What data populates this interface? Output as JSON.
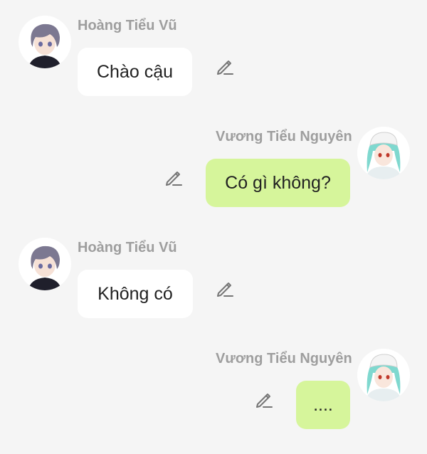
{
  "colors": {
    "background": "#f5f5f5",
    "left_bubble": "#ffffff",
    "right_bubble": "#d6f59b",
    "name_text": "#9e9e9e",
    "message_text": "#222222",
    "icon": "#757575"
  },
  "messages": [
    {
      "side": "left",
      "sender": "Hoàng Tiểu Vũ",
      "text": "Chào cậu",
      "avatar_icon": "boy-avatar-icon",
      "action_icon": "pencil-icon"
    },
    {
      "side": "right",
      "sender": "Vương Tiểu Nguyên",
      "text": "Có gì không?",
      "avatar_icon": "girl-avatar-icon",
      "action_icon": "pencil-icon"
    },
    {
      "side": "left",
      "sender": "Hoàng Tiểu Vũ",
      "text": "Không có",
      "avatar_icon": "boy-avatar-icon",
      "action_icon": "pencil-icon"
    },
    {
      "side": "right",
      "sender": "Vương Tiểu Nguyên",
      "text": "....",
      "avatar_icon": "girl-avatar-icon",
      "action_icon": "pencil-icon"
    }
  ]
}
